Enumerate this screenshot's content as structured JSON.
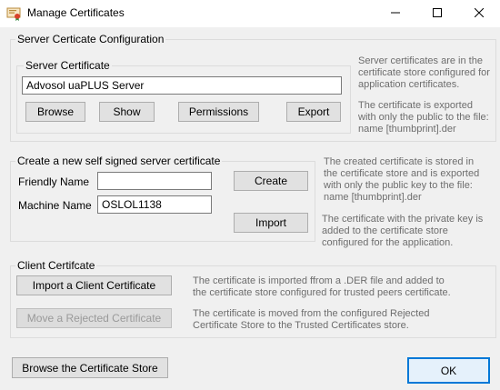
{
  "window": {
    "title": "Manage Certificates"
  },
  "server_config": {
    "group_label": "Server Certicate Configuration",
    "cert_group_label": "Server Certificate",
    "cert_name": "Advosol uaPLUS Server",
    "buttons": {
      "browse": "Browse",
      "show": "Show",
      "permissions": "Permissions",
      "export": "Export"
    },
    "note1": "Server certificates are in the certificate store configured for application certificates.",
    "note2": "The certificate is exported with only the public to the file: name [thumbprint].der"
  },
  "self_signed": {
    "group_label": "Create a new self signed server certificate",
    "friendly_name_label": "Friendly Name",
    "friendly_name_value": "",
    "machine_name_label": "Machine Name",
    "machine_name_value": "OSLOL1138",
    "create_label": "Create",
    "import_label": "Import",
    "note1": "The created certificate is stored in the certificate store and is exported with only the public key to the file: name [thumbprint].der",
    "note2": "The certificate with the private key is added to the certificate store configured for the application."
  },
  "client": {
    "group_label": "Client Certifcate",
    "import_label": "Import a Client Certificate",
    "import_note": "The certificate is imported ffrom a .DER file and added to the certificate store configured for trusted peers certificate.",
    "move_label": "Move a Rejected Certificate",
    "move_note": "The certificate is moved from the configured Rejected Certificate Store to the Trusted Certificates store."
  },
  "footer": {
    "browse_store_label": "Browse the Certificate Store",
    "ok_label": "OK"
  },
  "icons": {
    "app": "certificate-app-icon",
    "minimize": "minimize-icon",
    "maximize": "maximize-icon",
    "close": "close-icon"
  }
}
